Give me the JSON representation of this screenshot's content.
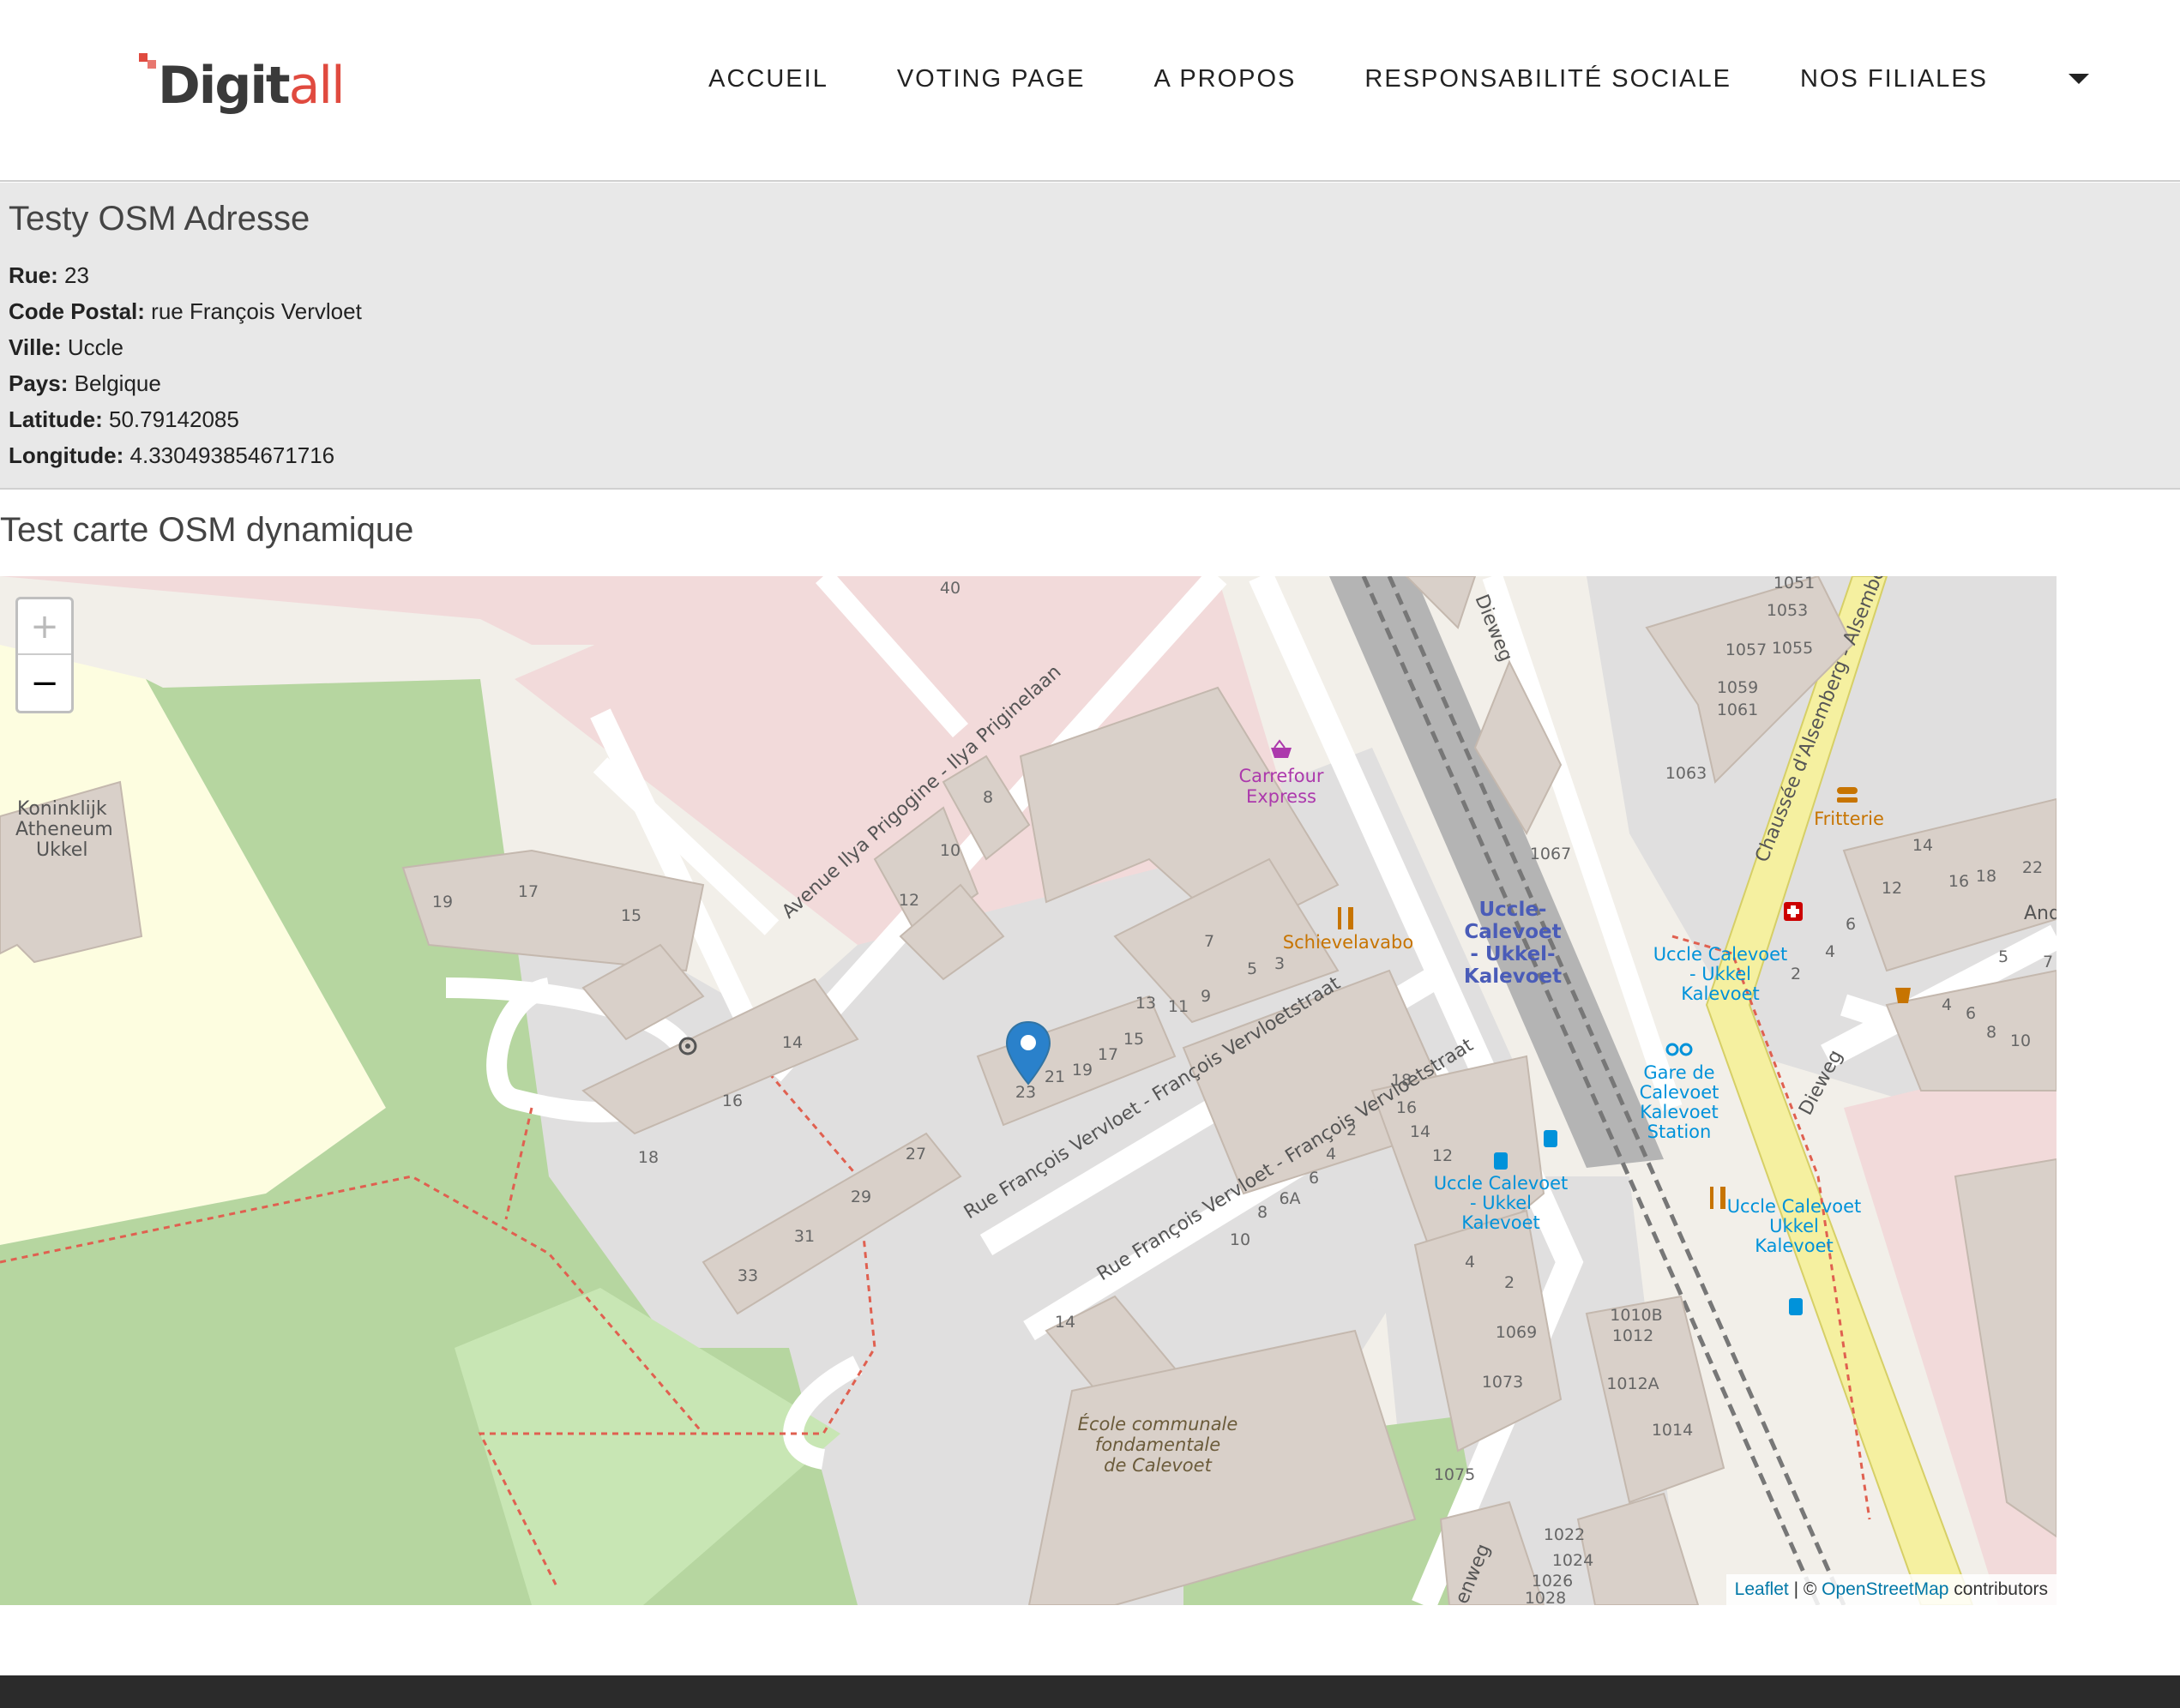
{
  "header": {
    "logo": {
      "text_main": "Digit",
      "text_accent": "all"
    },
    "nav": [
      "ACCUEIL",
      "VOTING PAGE",
      "A PROPOS",
      "RESPONSABILITÉ SOCIALE",
      "NOS FILIALES"
    ],
    "dropdown_icon": "caret-down-icon"
  },
  "address": {
    "title": "Testy OSM Adresse",
    "rows": [
      {
        "label": "Rue:",
        "value": "23"
      },
      {
        "label": "Code Postal:",
        "value": "rue François Vervloet"
      },
      {
        "label": "Ville:",
        "value": "Uccle"
      },
      {
        "label": "Pays:",
        "value": "Belgique"
      },
      {
        "label": "Latitude:",
        "value": "50.79142085"
      },
      {
        "label": "Longitude:",
        "value": "4.330493854671716"
      }
    ]
  },
  "map": {
    "title": "Test carte OSM dynamique",
    "zoom_in": "+",
    "zoom_out": "−",
    "attribution": {
      "leaflet": "Leaflet",
      "sep": " | © ",
      "osm": "OpenStreetMap",
      "suffix": " contributors"
    },
    "labels": {
      "school_top": "Koninklijk",
      "school_mid": "Atheneum",
      "school_bot": "Ukkel",
      "avenue": "Avenue Ilya Prigogine - Ilya Priginelaan",
      "rue1": "Rue François Vervloet - François Vervloetstraat",
      "rue2": "Rue François Vervloet - François Vervloetstraat",
      "carrefour1": "Carrefour",
      "carrefour2": "Express",
      "schievelavabo": "Schievelavabo",
      "station1": "Uccle-",
      "station2": "Calevoet",
      "station3": "- Ukkel-",
      "station4": "Kalevoet",
      "dieweg": "Dieweg",
      "dieweg2": "Dieweg",
      "chaussee": "Chaussée d'Alsemberg - Alsemberg",
      "fritterie": "Fritterie",
      "stop1a": "Uccle Calevoet",
      "stop1b": "- Ukkel",
      "stop1c": "Kalevoet",
      "gare1": "Gare de",
      "gare2": "Calevoet",
      "gare3": "Kalevoet",
      "gare4": "Station",
      "stop2a": "Uccle Calevoet",
      "stop2b": "- Ukkel",
      "stop2c": "Kalevoet",
      "stop3a": "Uccle Calevoet",
      "stop3b": "Ukkel",
      "stop3c": "Kalevoet",
      "ecole1": "École communale",
      "ecole2": "fondamentale",
      "ecole3": "de Calevoet",
      "enweg": "enweg",
      "and": "And"
    },
    "house_numbers": [
      "40",
      "8",
      "10",
      "12",
      "19",
      "17",
      "15",
      "14",
      "16",
      "18",
      "27",
      "29",
      "31",
      "33",
      "23",
      "21",
      "19",
      "17",
      "15",
      "13",
      "11",
      "9",
      "7",
      "5",
      "3",
      "18",
      "16",
      "14",
      "12",
      "2",
      "4",
      "6",
      "6A",
      "8",
      "10",
      "4",
      "2",
      "14",
      "1069",
      "1073",
      "1075",
      "1067",
      "1063",
      "1061",
      "1059",
      "1057",
      "1055",
      "1053",
      "1051",
      "14",
      "12",
      "16",
      "18",
      "22",
      "6",
      "4",
      "2",
      "5",
      "7",
      "4",
      "6",
      "8",
      "10",
      "1010B",
      "1012",
      "1012A",
      "1014",
      "1022",
      "1024",
      "1026",
      "1028"
    ]
  }
}
